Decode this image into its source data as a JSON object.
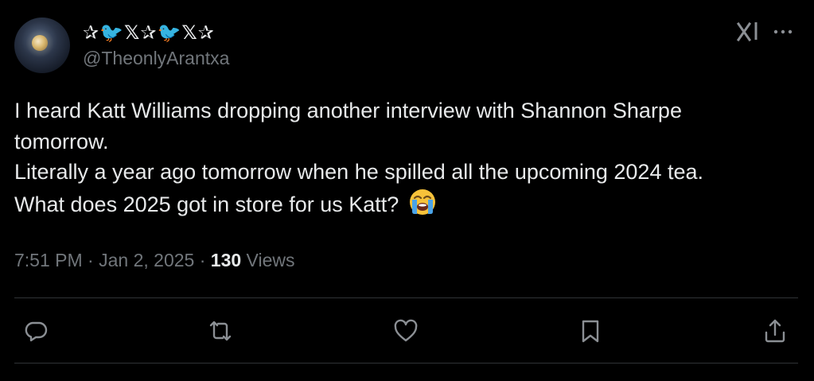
{
  "author": {
    "display_name": "✰🐦𝕏✰🐦𝕏✰",
    "handle": "@TheonlyArantxa",
    "avatar": "night-sky-moon-avatar"
  },
  "tweet": {
    "lines": [
      "I heard Katt Williams dropping another interview with Shannon Sharpe",
      "tomorrow.",
      "Literally a year ago tomorrow when he spilled all the upcoming 2024 tea.",
      "What does 2025 got in store for us Katt?"
    ],
    "emoji": "loudly-crying-face"
  },
  "meta": {
    "time": "7:51 PM",
    "separator": " · ",
    "date": "Jan 2, 2025",
    "views_count": "130",
    "views_label": "Views"
  },
  "icons": {
    "grok": "grok-icon",
    "more": "more-icon",
    "reply": "reply-icon",
    "repost": "repost-icon",
    "like": "like-icon",
    "bookmark": "bookmark-icon",
    "share": "share-icon"
  },
  "colors": {
    "background": "#000000",
    "text_primary": "#e7e9ea",
    "text_secondary": "#71767b",
    "divider": "#2f3336"
  }
}
